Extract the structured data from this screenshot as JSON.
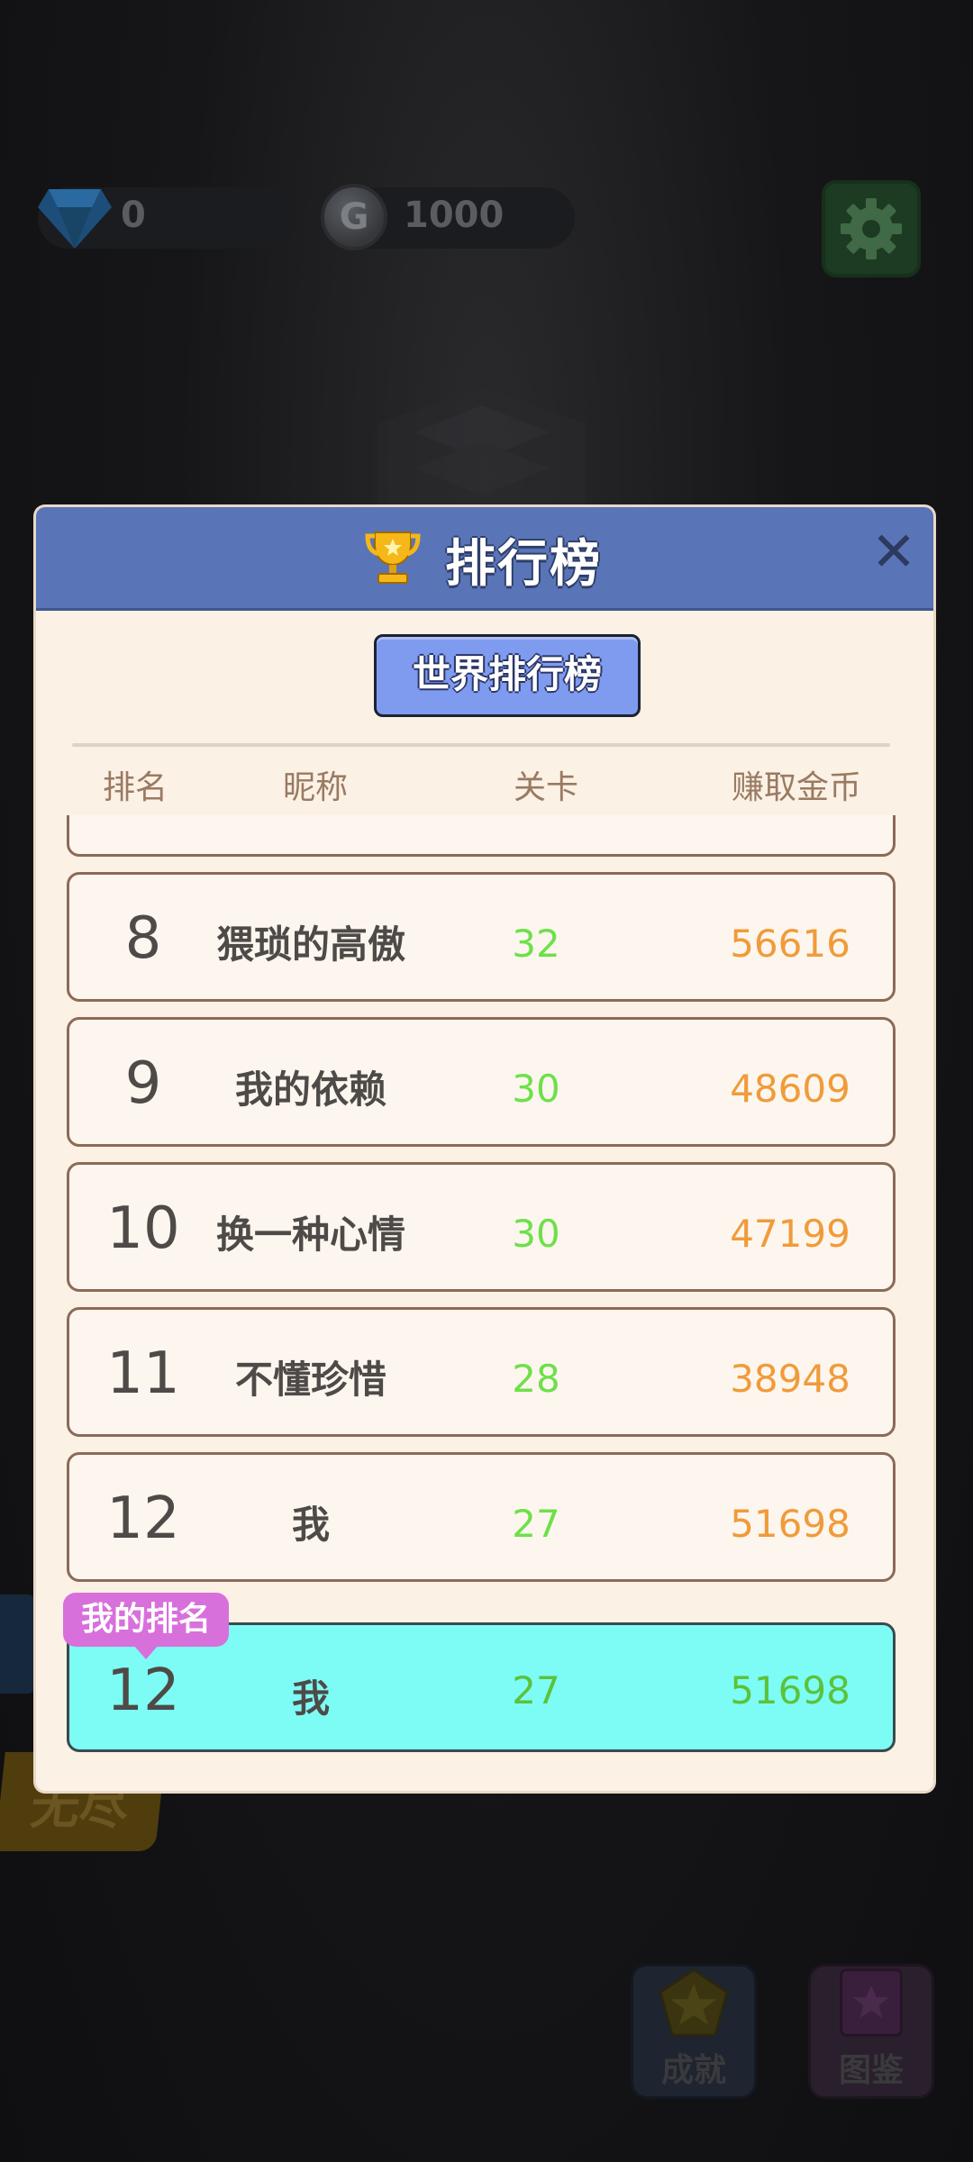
{
  "hud": {
    "gems": "0",
    "coins": "1000",
    "coin_symbol": "G"
  },
  "background": {
    "endless_label": "无尽",
    "achievements_label": "成就",
    "atlas_label": "图鉴"
  },
  "modal": {
    "title": "排行榜",
    "close_symbol": "✕",
    "tab_label": "世界排行榜",
    "columns": {
      "rank": "排名",
      "nickname": "昵称",
      "level": "关卡",
      "coins": "赚取金币"
    },
    "rows": [
      {
        "rank": "8",
        "name": "猥琐的高傲",
        "level": "32",
        "coins": "56616"
      },
      {
        "rank": "9",
        "name": "我的依赖",
        "level": "30",
        "coins": "48609"
      },
      {
        "rank": "10",
        "name": "换一种心情",
        "level": "30",
        "coins": "47199"
      },
      {
        "rank": "11",
        "name": "不懂珍惜",
        "level": "28",
        "coins": "38948"
      },
      {
        "rank": "12",
        "name": "我",
        "level": "27",
        "coins": "51698"
      }
    ],
    "my_rank_label": "我的排名",
    "my_row": {
      "rank": "12",
      "name": "我",
      "level": "27",
      "coins": "51698"
    }
  },
  "colors": {
    "header_blue": "#5a74b8",
    "tab_blue": "#7f9bf0",
    "level_green": "#6ee04a",
    "coins_orange": "#f09b3a",
    "my_row_cyan": "#7dfcf5",
    "badge_pink": "#d870dc"
  }
}
